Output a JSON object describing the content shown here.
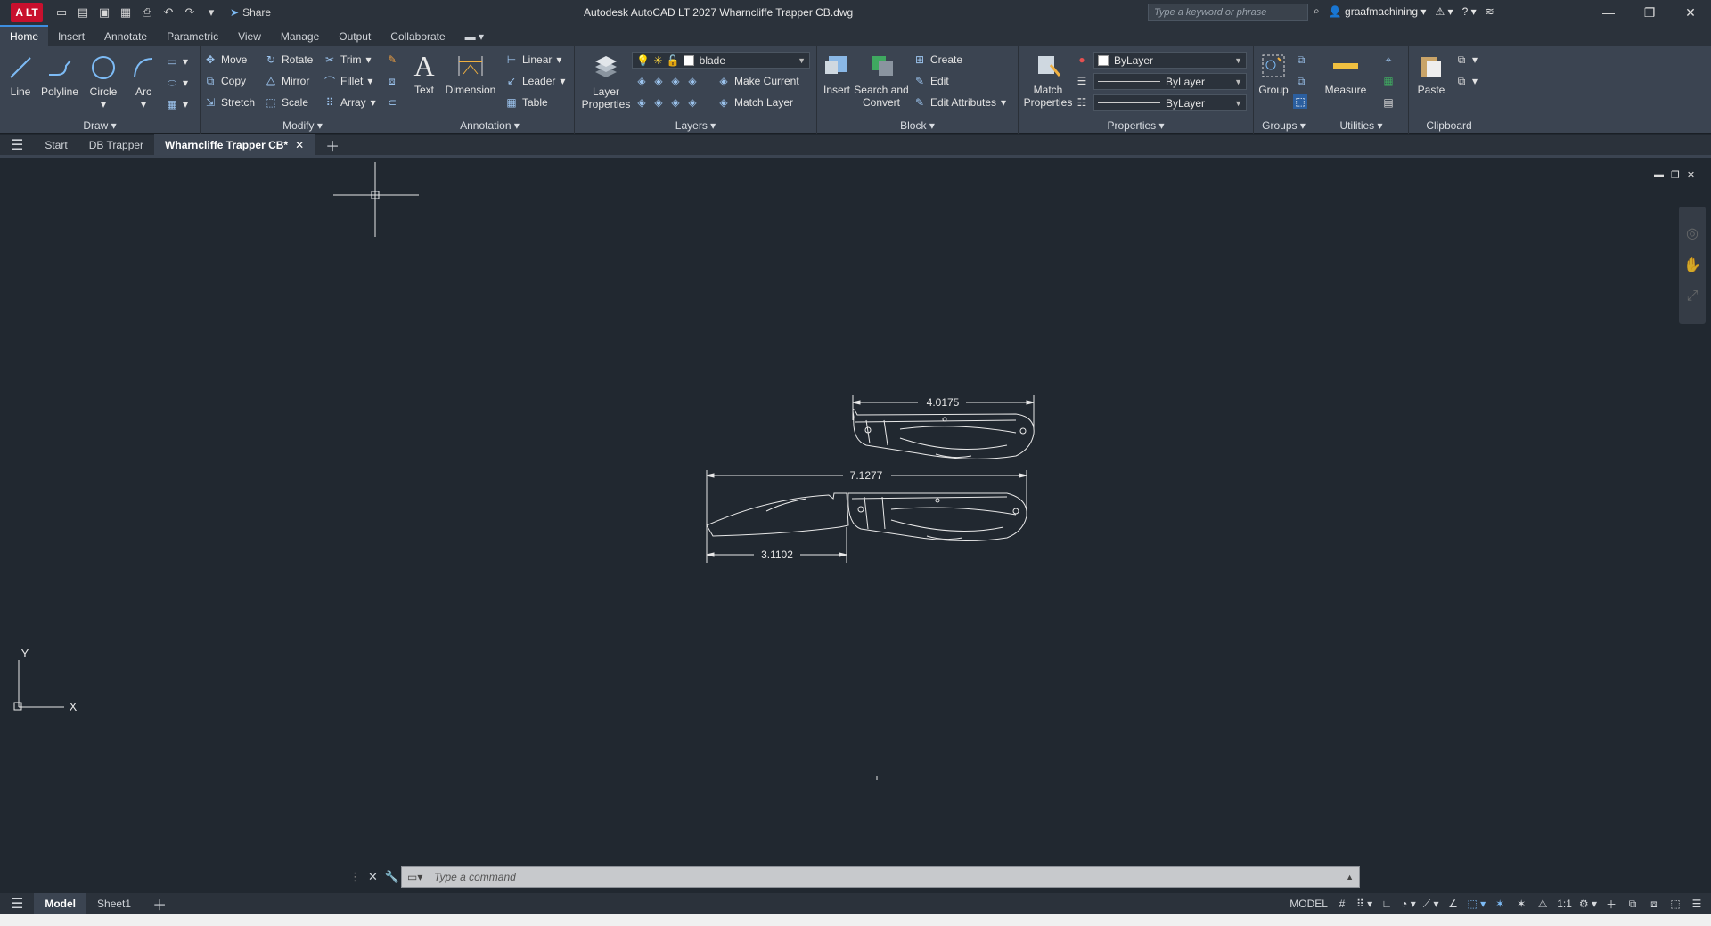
{
  "titlebar": {
    "app_button": "A LT",
    "share": "Share",
    "title": "Autodesk AutoCAD LT 2027   Wharncliffe Trapper CB.dwg",
    "search_placeholder": "Type a keyword or phrase",
    "user": "graafmachining"
  },
  "tabs": [
    "Home",
    "Insert",
    "Annotate",
    "Parametric",
    "View",
    "Manage",
    "Output",
    "Collaborate"
  ],
  "ribbon": {
    "draw": {
      "title": "Draw",
      "line": "Line",
      "polyline": "Polyline",
      "circle": "Circle",
      "arc": "Arc"
    },
    "modify": {
      "title": "Modify",
      "move": "Move",
      "rotate": "Rotate",
      "trim": "Trim",
      "copy": "Copy",
      "mirror": "Mirror",
      "fillet": "Fillet",
      "stretch": "Stretch",
      "scale": "Scale",
      "array": "Array"
    },
    "annotation": {
      "title": "Annotation",
      "text": "Text",
      "dimension": "Dimension",
      "linear": "Linear",
      "leader": "Leader",
      "table": "Table"
    },
    "layers": {
      "title": "Layers",
      "layer_properties": "Layer Properties",
      "current_layer": "blade",
      "make_current": "Make Current",
      "match_layer": "Match Layer"
    },
    "block": {
      "title": "Block",
      "insert": "Insert",
      "search_convert": "Search and Convert",
      "create": "Create",
      "edit": "Edit",
      "edit_attributes": "Edit Attributes"
    },
    "properties": {
      "title": "Properties",
      "match_properties": "Match Properties",
      "color": "ByLayer",
      "linetype": "ByLayer",
      "lineweight": "ByLayer"
    },
    "groups": {
      "title": "Groups",
      "group": "Group"
    },
    "utilities": {
      "title": "Utilities",
      "measure": "Measure"
    },
    "clipboard": {
      "title": "Clipboard",
      "paste": "Paste"
    }
  },
  "doc_tabs": [
    "Start",
    "DB Trapper",
    "Wharncliffe Trapper CB*"
  ],
  "drawing": {
    "dims": {
      "top_length": "4.0175",
      "open_length": "7.1277",
      "blade_length": "3.1102"
    },
    "ucs": {
      "x": "X",
      "y": "Y"
    }
  },
  "command": {
    "placeholder": "Type a command"
  },
  "layout_tabs": [
    "Model",
    "Sheet1"
  ],
  "status": {
    "model": "MODEL",
    "scale": "1:1"
  },
  "colors": {
    "canvas": "#212830",
    "ribbon": "#3b4451",
    "accent": "#3d8ee0"
  }
}
